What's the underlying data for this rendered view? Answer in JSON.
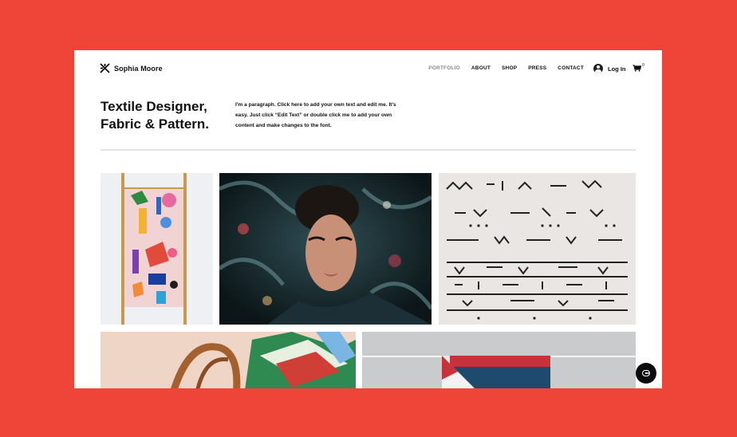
{
  "brand": {
    "name": "Sophia Moore",
    "icon": "crossed-x-logo-icon"
  },
  "nav": {
    "items": [
      {
        "label": "PORTFOLIO",
        "active": true
      },
      {
        "label": "ABOUT",
        "active": false
      },
      {
        "label": "SHOP",
        "active": false
      },
      {
        "label": "PRESS",
        "active": false
      },
      {
        "label": "CONTACT",
        "active": false
      }
    ]
  },
  "account": {
    "login_label": "Log In",
    "icon": "user-avatar-icon"
  },
  "cart": {
    "count": "0",
    "icon": "shopping-cart-icon"
  },
  "hero": {
    "headline_line1": "Textile Designer,",
    "headline_line2": "Fabric & Pattern.",
    "paragraph": "I'm a paragraph. Click here to add your own text and edit me. It's easy. Just click “Edit Text” or double click me to add your own content and make changes to the font."
  },
  "gallery": {
    "tiles": [
      {
        "subject": "colorful patterned blanket on wooden ladder"
      },
      {
        "subject": "woman wrapped in dark floral fabric"
      },
      {
        "subject": "stacked black and white mudcloth fabrics"
      },
      {
        "subject": "leather bag with silk scarf"
      },
      {
        "subject": "folded striped towel on rail"
      }
    ]
  },
  "chat": {
    "icon": "chat-bubble-icon"
  },
  "colors": {
    "page_background": "#ef4438",
    "site_background": "#ffffff",
    "text": "#111111",
    "active_nav": "#8a8a8a"
  }
}
